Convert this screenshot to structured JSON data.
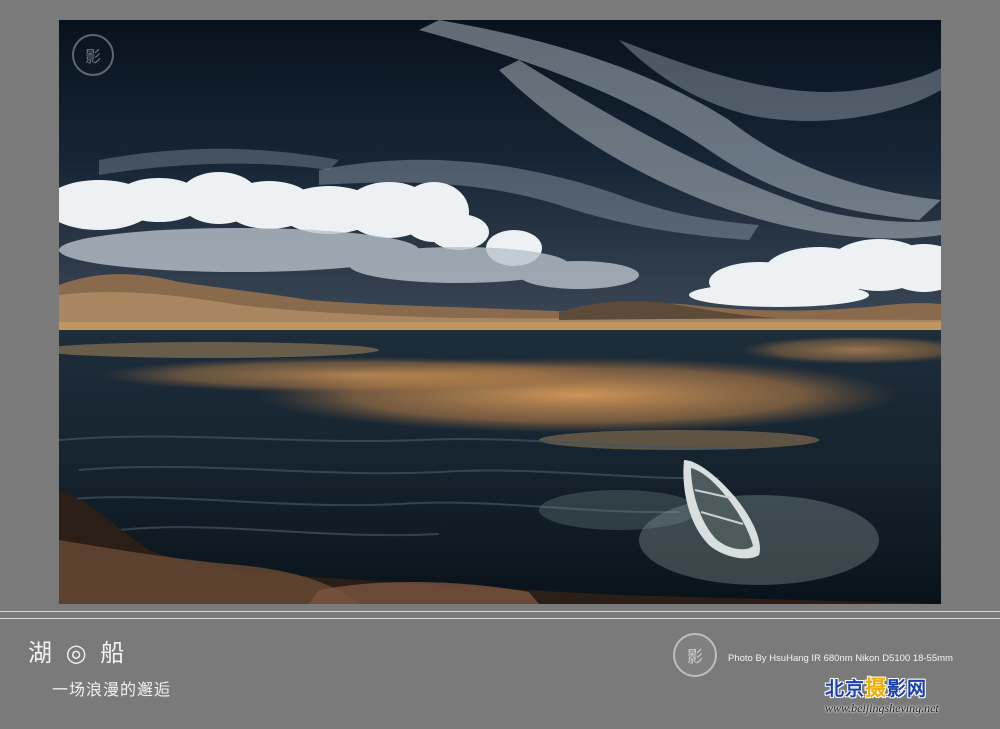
{
  "photo": {
    "subject": "lake-boat-infrared-landscape"
  },
  "caption": {
    "title": "湖 ◎ 船",
    "subtitle": "一场浪漫的邂逅",
    "credit": "Photo By HsuHang   IR 680nm  Nikon D5100  18-55mm"
  },
  "seal_icon": "seal-icon",
  "seal_glyph": "影",
  "logo": {
    "chars": [
      "北",
      "京",
      "摄",
      "影",
      "网"
    ],
    "url": "www.beijingsheying.net"
  },
  "colors": {
    "background": "#7a7a7a",
    "logo_blue": "#1a3fb0",
    "logo_yellow": "#f0b000"
  }
}
